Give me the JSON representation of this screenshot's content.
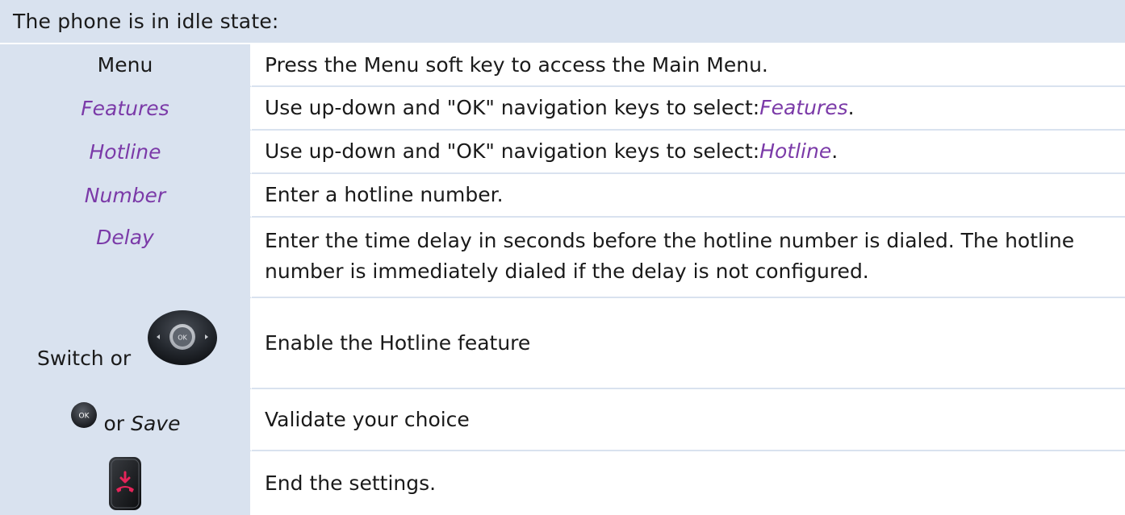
{
  "header": {
    "title": "The phone is in idle state:"
  },
  "rows": [
    {
      "left": "Menu",
      "right": "Press the Menu soft key to access the Main Menu."
    },
    {
      "left": "Features",
      "right_prefix": "Use up-down and \"OK\" navigation keys to select: ",
      "right_highlight": "Features",
      "right_suffix": "."
    },
    {
      "left": "Hotline",
      "right_prefix": "Use up-down and \"OK\" navigation keys to select: ",
      "right_highlight": "Hotline",
      "right_suffix": "."
    },
    {
      "left": "Number",
      "right": "Enter a hotline number."
    },
    {
      "left": "Delay",
      "right": "Enter the time delay in seconds before the hotline number is dialed. The hotline number is immediately dialed if the delay is not configured."
    },
    {
      "left_text": "Switch or",
      "left_icon": "navigation-ok-key-icon",
      "right": "Enable the Hotline feature"
    },
    {
      "left_icon": "ok-key-icon",
      "left_text": "or",
      "left_italic": "Save",
      "right": "Validate your choice"
    },
    {
      "left_icon": "hang-up-key-icon",
      "right": "End the settings."
    }
  ],
  "colors": {
    "header_bg": "#d9e2ef",
    "accent_purple": "#7b3aa8",
    "hangup_red": "#e6245a"
  }
}
